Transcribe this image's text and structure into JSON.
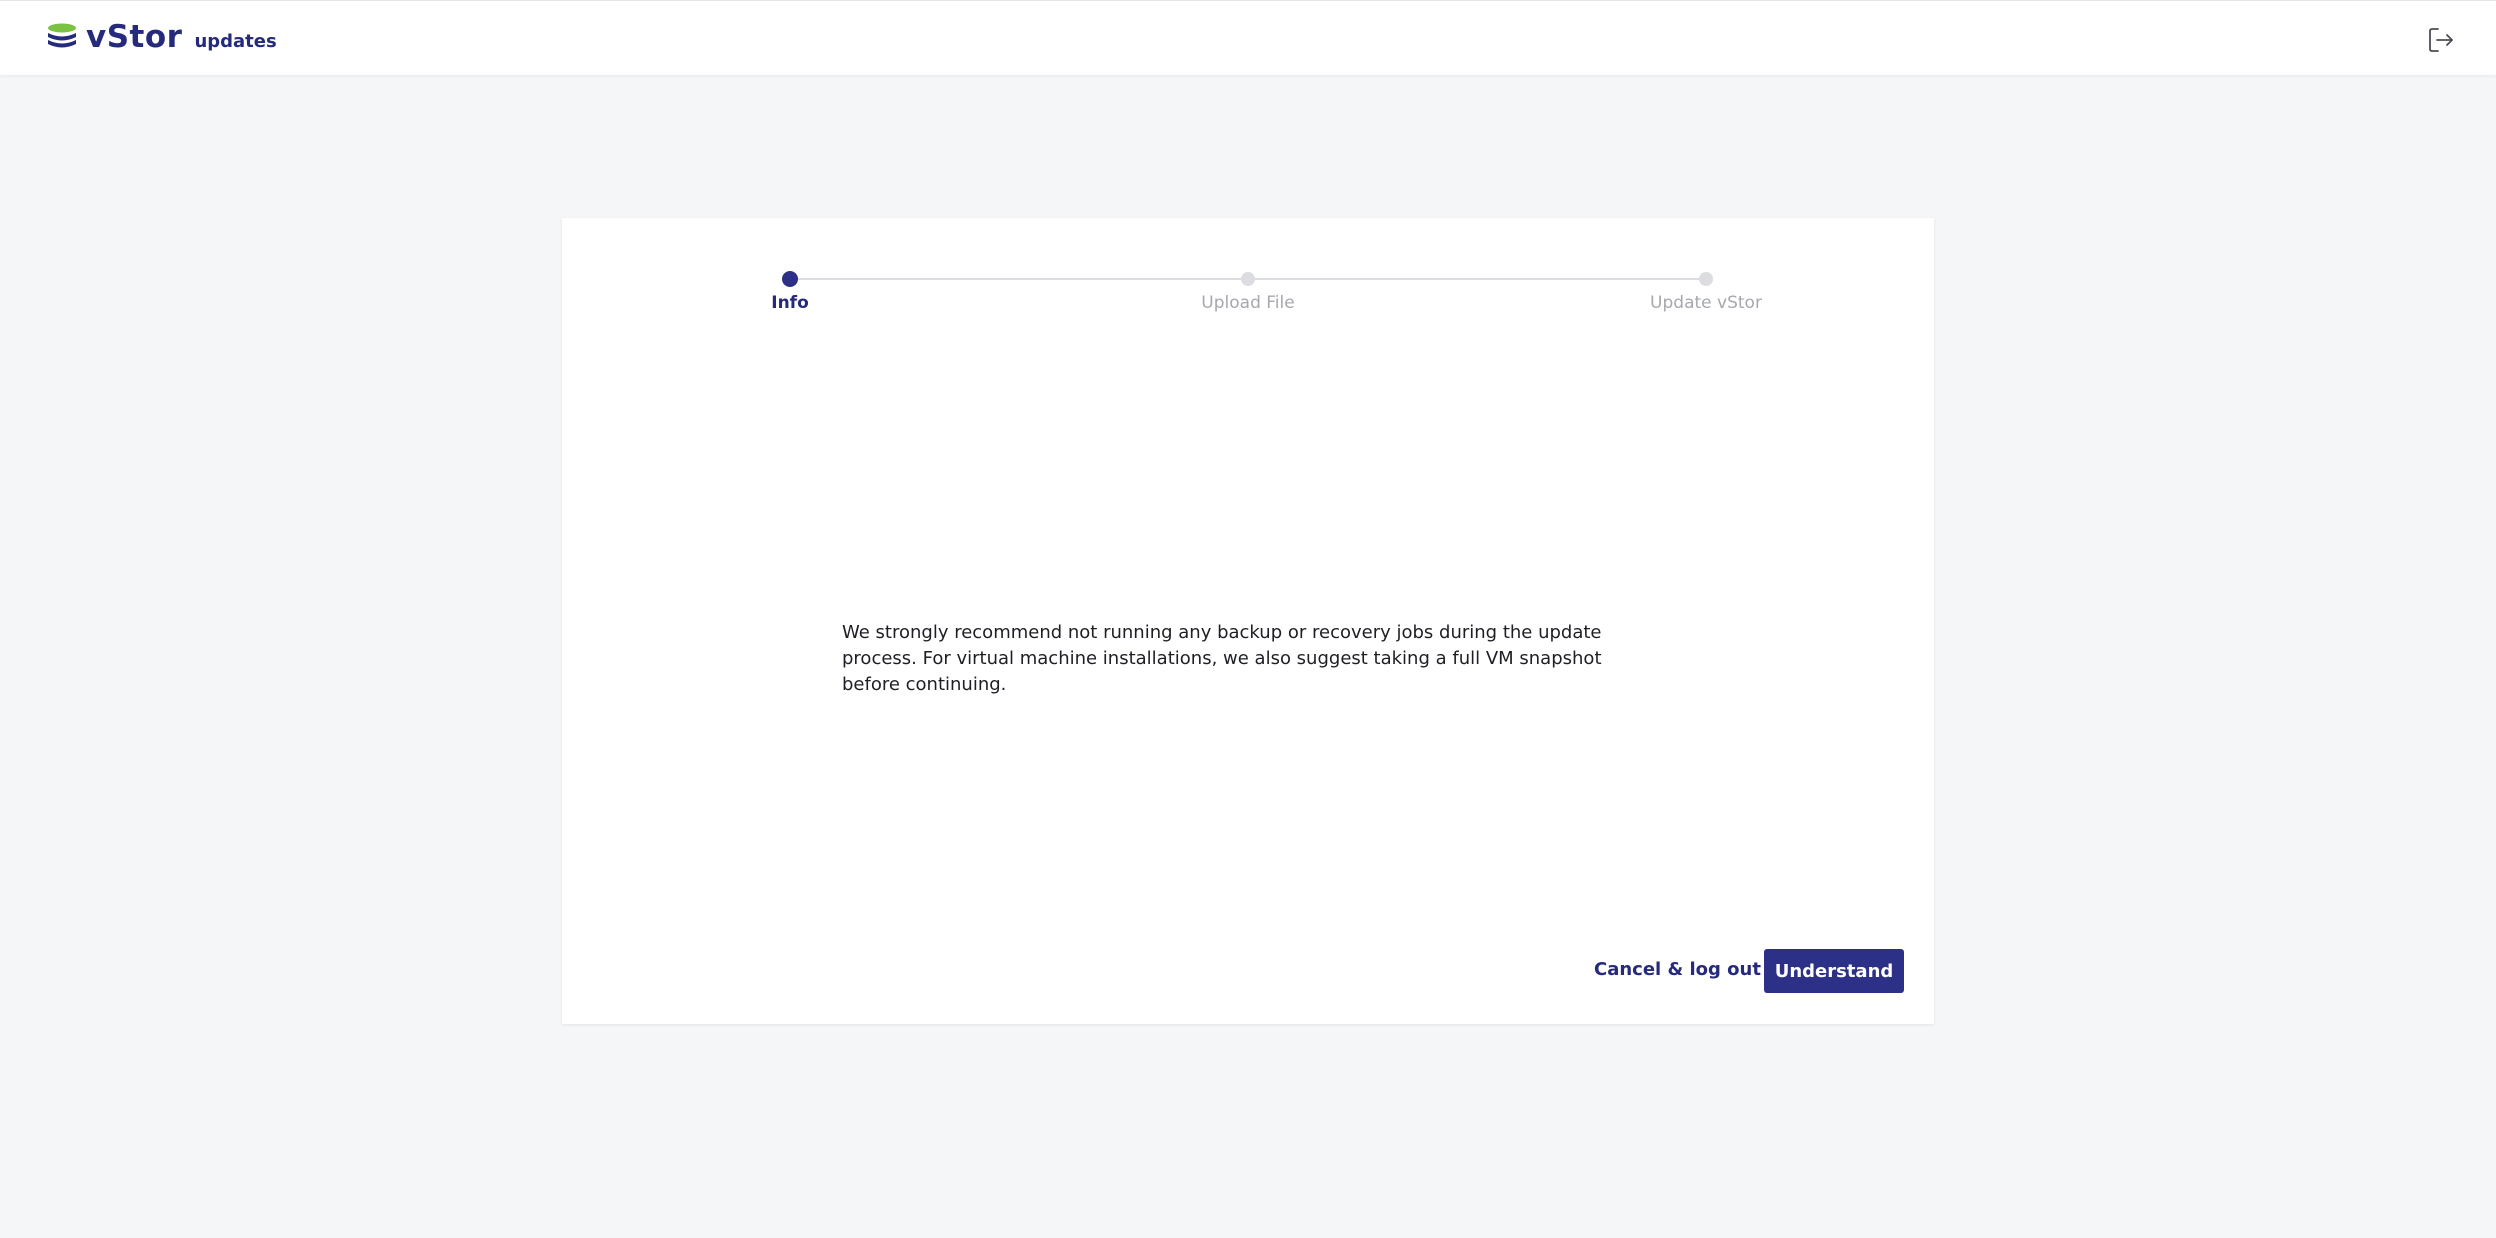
{
  "header": {
    "brand_name": "vStor",
    "brand_sub": "updates",
    "logo_icon": "database-stack-icon",
    "logout_icon": "logout-icon",
    "colors": {
      "brand": "#262a7d",
      "logo_accent": "#7cc242"
    }
  },
  "stepper": {
    "steps": [
      {
        "label": "Info",
        "state": "active"
      },
      {
        "label": "Upload File",
        "state": "inactive"
      },
      {
        "label": "Update vStor",
        "state": "inactive"
      }
    ]
  },
  "content": {
    "message": "We strongly recommend not running any backup or recovery jobs during the update process. For virtual machine installations, we also suggest taking a full VM snapshot before continuing."
  },
  "actions": {
    "cancel_label": "Cancel & log out",
    "confirm_label": "Understand"
  },
  "colors": {
    "primary": "#2c3087",
    "inactive": "#dcdde0",
    "background": "#f5f6f7"
  }
}
